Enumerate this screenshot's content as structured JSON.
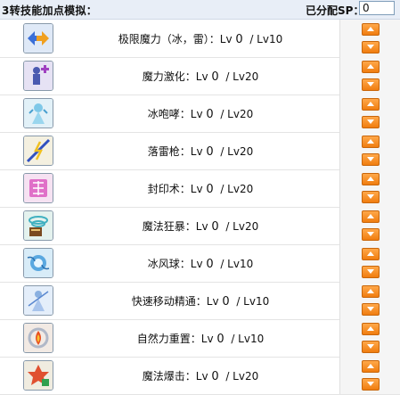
{
  "header": {
    "title": "3转技能加点模拟：",
    "sp_label": "已分配SP：",
    "sp_value": "0"
  },
  "skills": [
    {
      "name": "极限魔力（冰，雷）",
      "lv_prefix": "：Lv ",
      "current": "0",
      "max": "/ Lv10",
      "icon": "element-amplification-icon"
    },
    {
      "name": "魔力激化",
      "lv_prefix": "：Lv ",
      "current": "0",
      "max": "/ Lv20",
      "icon": "arcane-boost-icon"
    },
    {
      "name": "冰咆哮",
      "lv_prefix": "：Lv ",
      "current": "0",
      "max": "/ Lv20",
      "icon": "ice-roar-icon"
    },
    {
      "name": "落雷枪",
      "lv_prefix": "：Lv ",
      "current": "0",
      "max": "/ Lv20",
      "icon": "thunder-spear-icon"
    },
    {
      "name": "封印术",
      "lv_prefix": "：Lv ",
      "current": "0",
      "max": "/ Lv20",
      "icon": "seal-icon"
    },
    {
      "name": "魔法狂暴",
      "lv_prefix": "：Lv ",
      "current": "0",
      "max": "/ Lv20",
      "icon": "magic-frenzy-icon"
    },
    {
      "name": "冰风球",
      "lv_prefix": "：Lv ",
      "current": "0",
      "max": "/ Lv10",
      "icon": "ice-wind-ball-icon"
    },
    {
      "name": "快速移动精通",
      "lv_prefix": "：Lv ",
      "current": "0",
      "max": "/ Lv10",
      "icon": "teleport-mastery-icon"
    },
    {
      "name": "自然力重置",
      "lv_prefix": "：Lv ",
      "current": "0",
      "max": "/ Lv10",
      "icon": "elemental-reset-icon"
    },
    {
      "name": "魔法爆击",
      "lv_prefix": "：Lv ",
      "current": "0",
      "max": "/ Lv20",
      "icon": "magic-critical-icon"
    }
  ],
  "colors": {
    "header_bg": "#e8eef7",
    "button_orange": "#f07d10"
  }
}
